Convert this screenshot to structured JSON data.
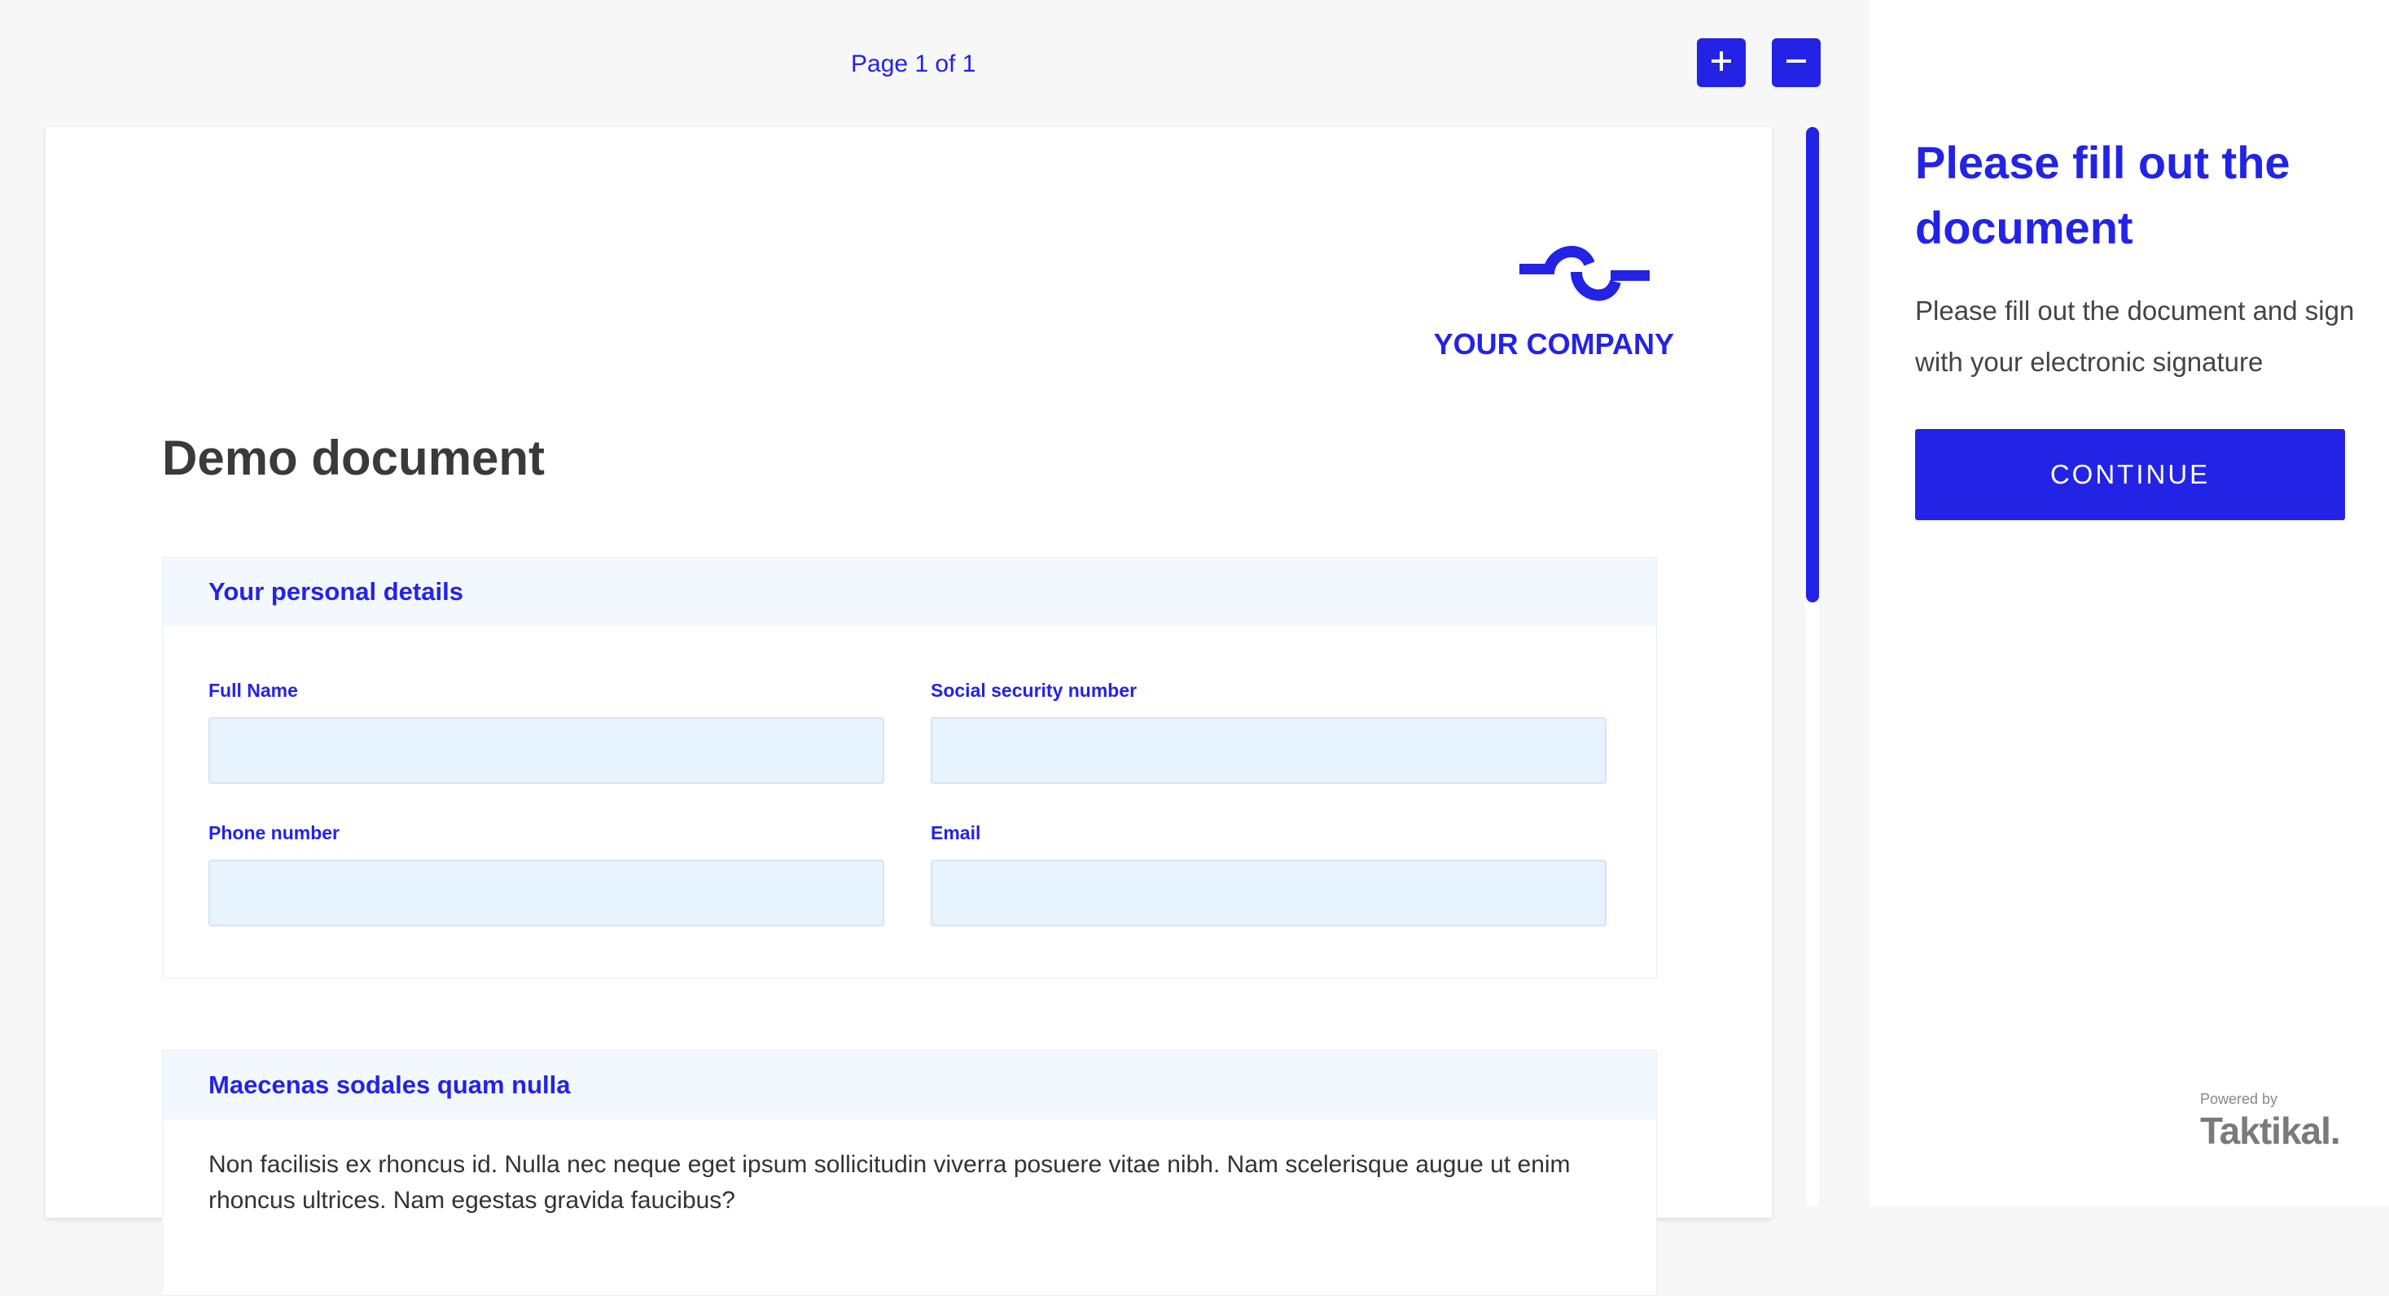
{
  "viewer": {
    "page_indicator": "Page 1 of 1",
    "zoom_in_icon": "plus-icon",
    "zoom_out_icon": "minus-icon"
  },
  "document": {
    "logo_icon": "company-logo-icon",
    "logo_text": "YOUR COMPANY",
    "title": "Demo document",
    "sections": [
      {
        "heading": "Your personal details",
        "fields": [
          {
            "label": "Full Name",
            "value": ""
          },
          {
            "label": "Social security number",
            "value": ""
          },
          {
            "label": "Phone number",
            "value": ""
          },
          {
            "label": "Email",
            "value": ""
          }
        ]
      },
      {
        "heading": "Maecenas sodales quam nulla",
        "body": "Non facilisis ex rhoncus id. Nulla nec neque eget ipsum sollicitudin viverra posuere vitae nibh. Nam scelerisque augue ut enim rhoncus ultrices. Nam egestas gravida faucibus?"
      }
    ]
  },
  "sidebar": {
    "title": "Please fill out the document",
    "description": "Please fill out the document and sign with your electronic signature",
    "continue_label": "CONTINUE",
    "powered_label": "Powered by",
    "powered_brand": "Taktikal."
  },
  "colors": {
    "accent": "#2323e6",
    "input_bg": "#e7f3fd",
    "section_head_bg": "#f3f7fe",
    "viewer_bg": "#f7f7f7"
  }
}
